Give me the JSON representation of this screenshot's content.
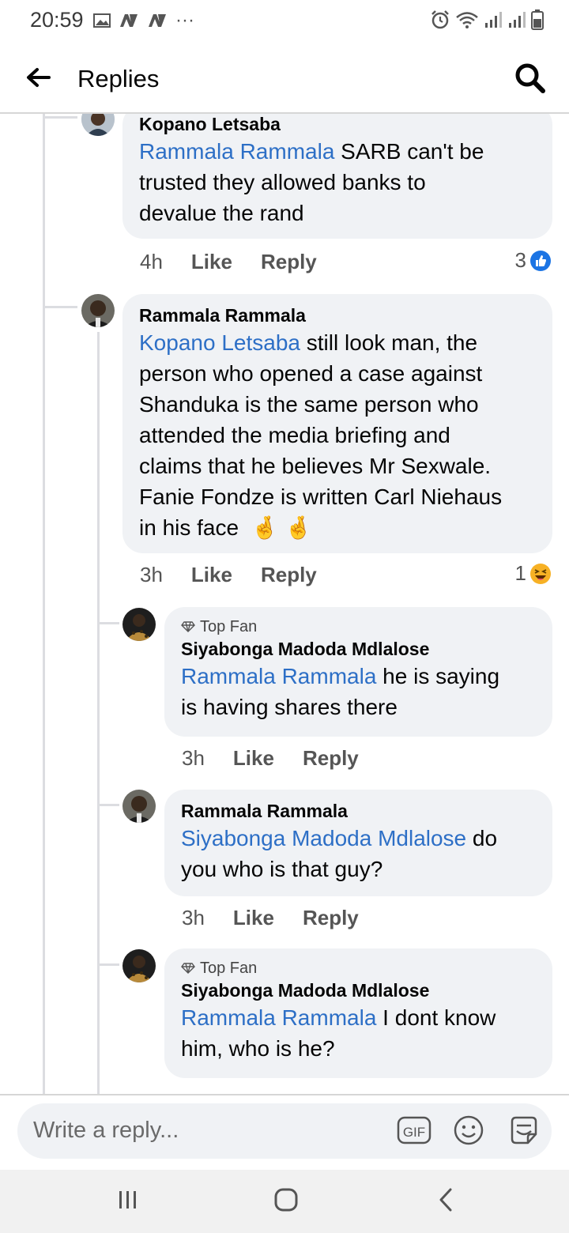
{
  "status": {
    "time": "20:59",
    "dots": "···"
  },
  "header": {
    "title": "Replies"
  },
  "comments": [
    {
      "author": "Kopano Letsaba",
      "mention": "Rammala Rammala",
      "text_lines": [
        " SARB can't be",
        "trusted they allowed banks to",
        "devalue the rand"
      ],
      "time": "4h",
      "like": "Like",
      "reply": "Reply",
      "reaction_count": "3",
      "reaction_type": "like-icon"
    },
    {
      "author": "Rammala Rammala",
      "mention": "Kopano Letsaba",
      "text_lines": [
        " still look man, the",
        "person who opened a case against",
        "Shanduka is the same person who",
        "attended the media briefing and",
        "claims that he believes Mr Sexwale.",
        "Fanie Fondze is written Carl Niehaus",
        "in his face"
      ],
      "emoji": "🤞 🤞",
      "time": "3h",
      "like": "Like",
      "reply": "Reply",
      "reaction_count": "1",
      "reaction_type": "haha-icon"
    },
    {
      "badge": "Top Fan",
      "author": "Siyabonga Madoda Mdlalose",
      "mention": "Rammala Rammala",
      "text_lines": [
        " he is saying",
        "is having shares there"
      ],
      "time": "3h",
      "like": "Like",
      "reply": "Reply"
    },
    {
      "author": "Rammala Rammala",
      "mention": "Siyabonga Madoda Mdlalose",
      "text_lines": [
        " do",
        "you who is that guy?"
      ],
      "time": "3h",
      "like": "Like",
      "reply": "Reply"
    },
    {
      "badge": "Top Fan",
      "author": "Siyabonga Madoda Mdlalose",
      "mention": "Rammala Rammala",
      "text_lines": [
        " I dont know",
        "him, who is he?"
      ]
    }
  ],
  "composer": {
    "placeholder": "Write a reply...",
    "gif_label": "GIF"
  },
  "colors": {
    "mention": "#2d6fc6",
    "bubble": "#f0f2f5",
    "like_blue": "#1b74e4",
    "haha_yellow": "#f7b125"
  }
}
